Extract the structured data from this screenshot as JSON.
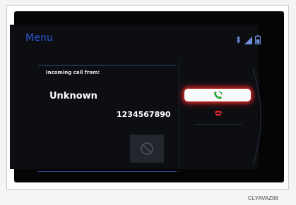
{
  "header": {
    "menu_label": "Menu",
    "status_icons": [
      "bluetooth-icon",
      "signal-icon",
      "battery-icon"
    ]
  },
  "call": {
    "incoming_label": "Incoming call from:",
    "caller_name": "Unknown",
    "caller_number": "1234567890",
    "ignore_icon": "no-entry-icon"
  },
  "actions": {
    "answer_icon": "phone-answer-icon",
    "decline_icon": "phone-hangup-icon"
  },
  "caption": "CLYAVAZ06",
  "colors": {
    "accent_blue": "#2b56d6",
    "answer_green": "#2ca836",
    "decline_red": "#e0262a",
    "highlight_glow": "#d12a2a"
  }
}
